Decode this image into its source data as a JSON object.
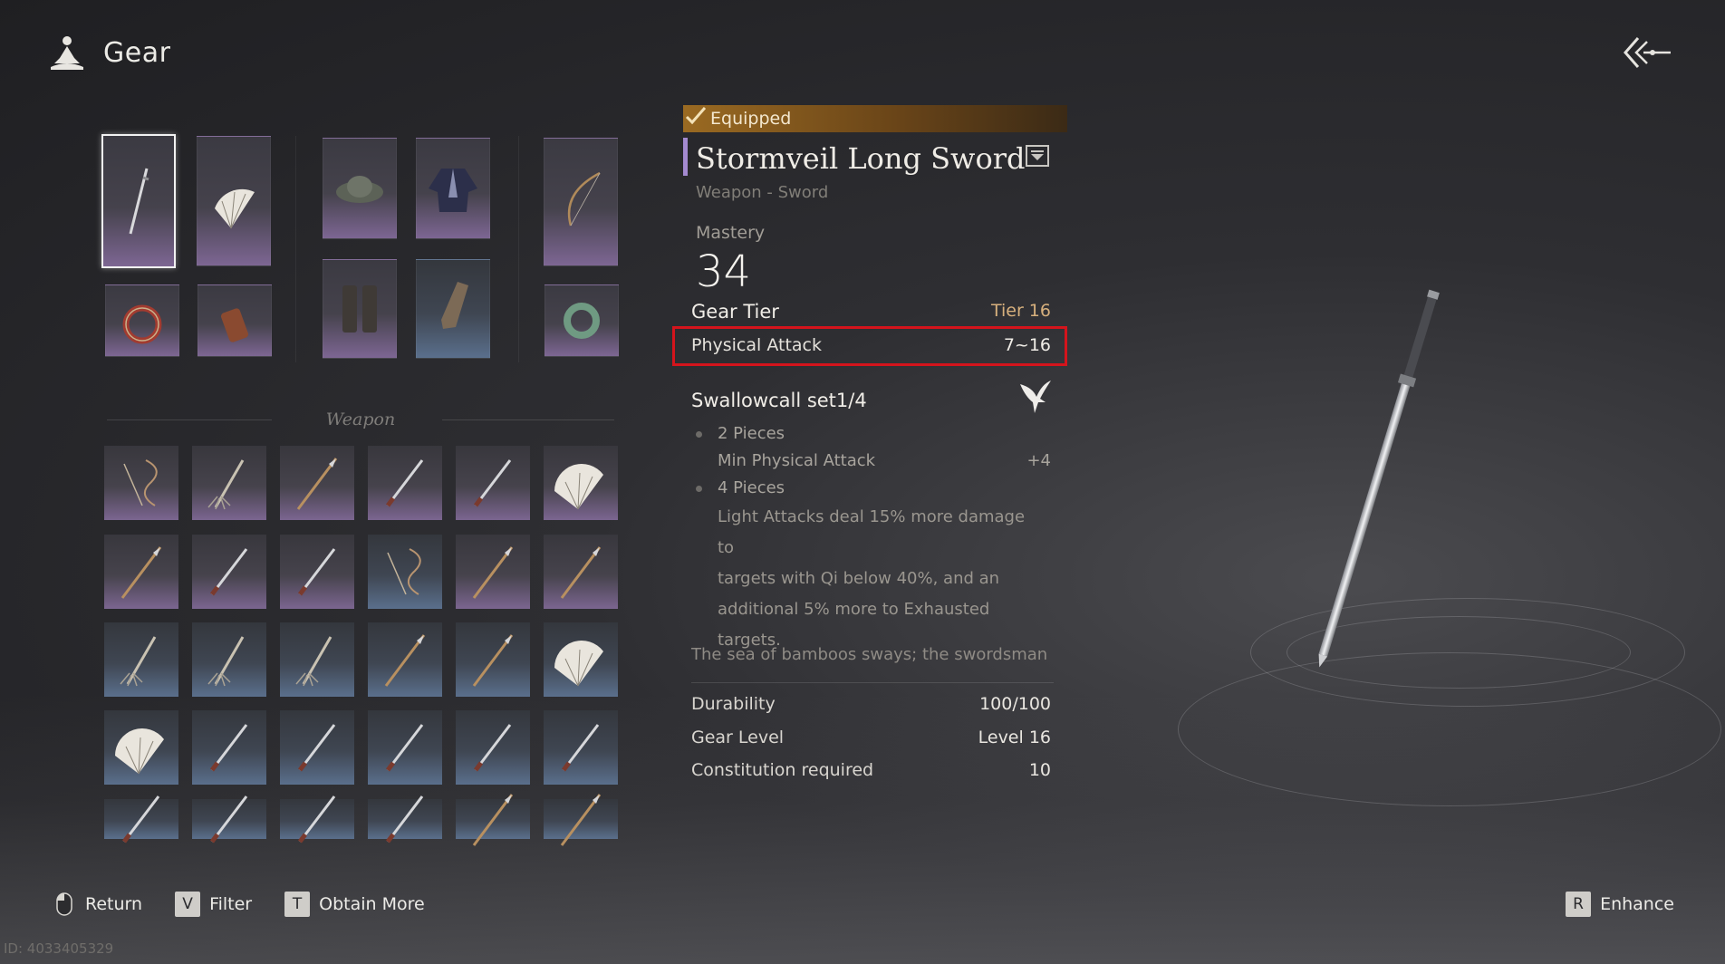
{
  "header": {
    "title": "Gear",
    "icon": "meditate-icon"
  },
  "equipped_slots": [
    {
      "name": "sword",
      "selected": true
    },
    {
      "name": "fan"
    },
    {
      "name": "hat"
    },
    {
      "name": "robe"
    },
    {
      "name": "bow"
    },
    {
      "name": "wrist-bracer"
    },
    {
      "name": "quiver"
    },
    {
      "name": "leg-guards"
    },
    {
      "name": "gauntlet"
    },
    {
      "name": "jade-ring"
    }
  ],
  "weapon_section": {
    "label": "Weapon",
    "rows": [
      [
        "rope-dart",
        "umbrella-blade",
        "spear",
        "sword",
        "sword",
        "fan"
      ],
      [
        "spear",
        "sword",
        "sword",
        "rope-dart",
        "spear",
        "spear"
      ],
      [
        "umbrella-blade",
        "umbrella-blade",
        "umbrella-blade",
        "spear",
        "spear",
        "fan"
      ],
      [
        "fan",
        "sword",
        "sword",
        "sword",
        "sword",
        "sword"
      ],
      [
        "sword",
        "sword",
        "sword",
        "sword",
        "spear",
        "spear"
      ]
    ]
  },
  "item": {
    "equipped_label": "Equipped",
    "name": "Stormveil Long Sword",
    "type": "Weapon - Sword",
    "mastery_label": "Mastery",
    "mastery_value": "34",
    "gear_tier_label": "Gear Tier",
    "gear_tier_value": "Tier 16",
    "physical_attack_label": "Physical Attack",
    "physical_attack_value": "7~16",
    "set": {
      "title": "Swallowcall set1/4",
      "piece2_label": "2 Pieces",
      "piece2_stat": "Min Physical Attack",
      "piece2_value": "+4",
      "piece4_label": "4 Pieces",
      "piece4_line1": "Light Attacks deal 15% more damage to",
      "piece4_line2": "targets with Qi below 40%, and an",
      "piece4_line3": "additional 5% more to Exhausted",
      "piece4_line4": "targets."
    },
    "flavor": "The sea of bamboos sways; the swordsman",
    "durability_label": "Durability",
    "durability_value": "100/100",
    "gear_level_label": "Gear Level",
    "gear_level_value": "Level 16",
    "constitution_label": "Constitution required",
    "constitution_value": "10"
  },
  "bottom_bar": {
    "return_label": "Return",
    "filter_key": "V",
    "filter_label": "Filter",
    "obtain_key": "T",
    "obtain_label": "Obtain More",
    "enhance_key": "R",
    "enhance_label": "Enhance"
  },
  "uid": "ID: 4033405329",
  "colors": {
    "accent_purple": "#a48ad0",
    "equipped_gold": "#9a6a22",
    "highlight_red": "#d4141c",
    "tier_orange": "#d7b07d"
  }
}
